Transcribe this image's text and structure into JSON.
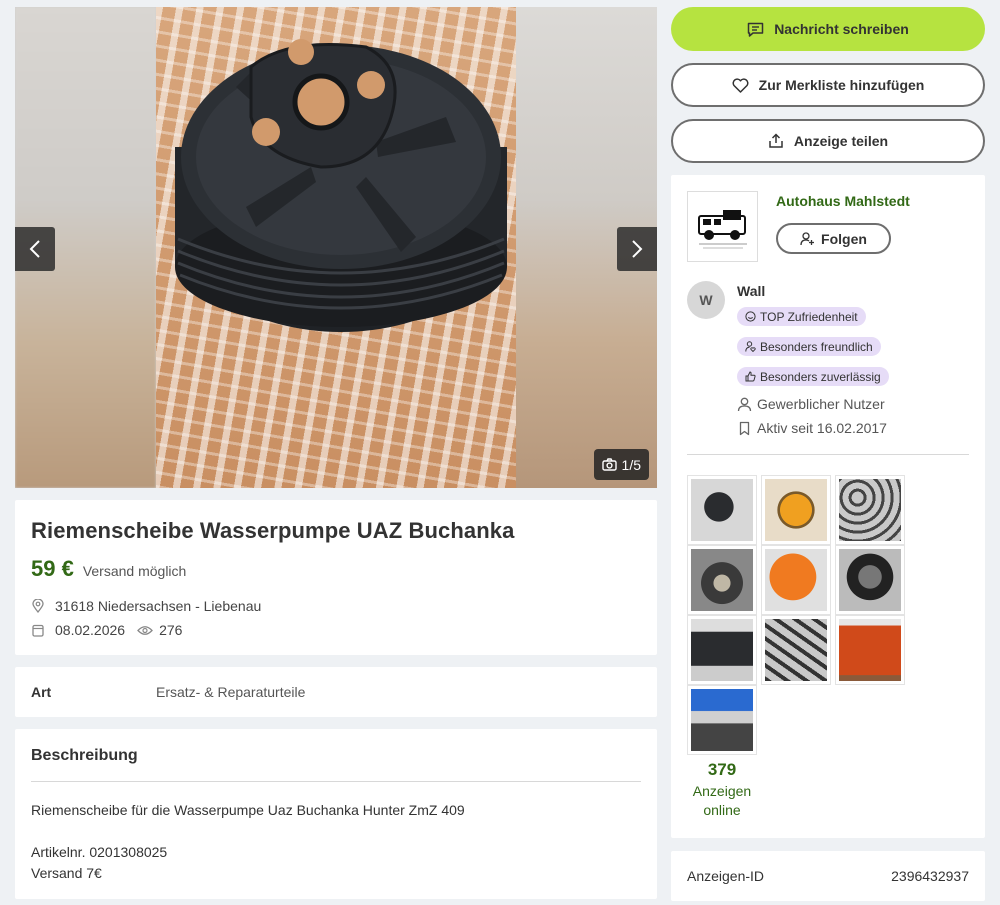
{
  "gallery": {
    "counter": "1/5"
  },
  "listing": {
    "title": "Riemenscheibe Wasserpumpe UAZ Buchanka",
    "price": "59 €",
    "shipping": "Versand möglich",
    "location": "31618 Niedersachsen - Liebenau",
    "date": "08.02.2026",
    "views": "276"
  },
  "attributes": {
    "key": "Art",
    "value": "Ersatz- & Reparaturteile"
  },
  "description": {
    "heading": "Beschreibung",
    "line1": "Riemenscheibe für die Wasserpumpe Uaz Buchanka Hunter ZmZ 409",
    "line2": "Artikelnr. 0201308025",
    "line3": "Versand 7€"
  },
  "actions": {
    "message": "Nachricht schreiben",
    "watchlist": "Zur Merkliste hinzufügen",
    "share": "Anzeige teilen"
  },
  "seller": {
    "shop_name": "Autohaus Mahlstedt",
    "follow": "Folgen",
    "avatar_letter": "W",
    "user_name": "Wall",
    "badges": [
      "TOP Zufriedenheit",
      "Besonders freundlich",
      "Besonders zuverlässig"
    ],
    "type": "Gewerblicher Nutzer",
    "active_since": "Aktiv seit 16.02.2017",
    "ads_count": "379",
    "ads_label_1": "Anzeigen",
    "ads_label_2": "online"
  },
  "ad_id": {
    "label": "Anzeigen-ID",
    "value": "2396432937"
  },
  "colors": {
    "accent": "#b6e340",
    "green_text": "#326916",
    "badge_bg": "#e6dcf7"
  }
}
